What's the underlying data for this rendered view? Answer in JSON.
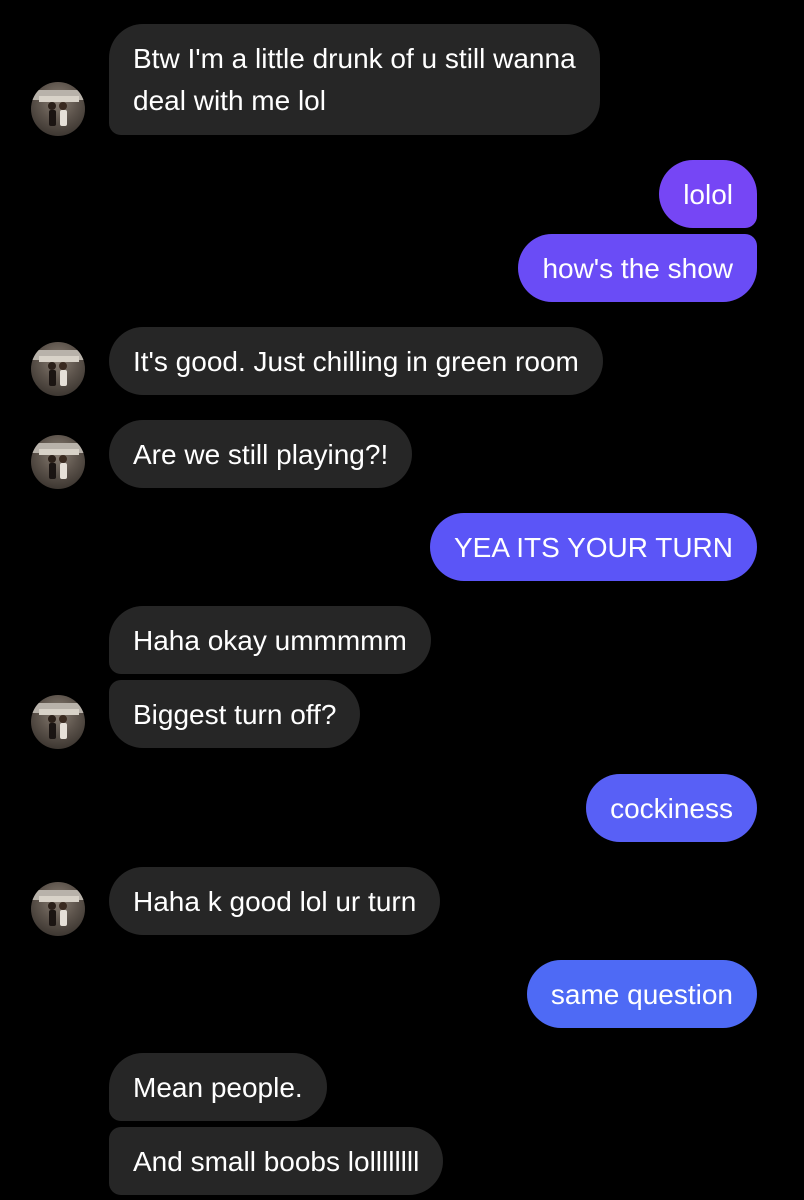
{
  "colors": {
    "background": "#000000",
    "incoming_bubble": "#262626",
    "outgoing_purple": "#7646F5",
    "outgoing_violet": "#6A4CF6",
    "outgoing_indigo": "#5B55F7",
    "outgoing_blue_violet": "#5860F6",
    "outgoing_blue": "#4E6AF5"
  },
  "icons": {
    "avatar": "contact-avatar-photo"
  },
  "messages": [
    {
      "direction": "incoming",
      "text_line1": "Btw I'm a little drunk of u still wanna",
      "text_line2": "deal with me lol"
    },
    {
      "direction": "outgoing",
      "text": "lolol"
    },
    {
      "direction": "outgoing",
      "text": "how's the show"
    },
    {
      "direction": "incoming",
      "text": "It's good. Just chilling in green room"
    },
    {
      "direction": "incoming",
      "text": "Are we still playing?!"
    },
    {
      "direction": "outgoing",
      "text": "YEA ITS YOUR TURN"
    },
    {
      "direction": "incoming",
      "text": "Haha okay ummmmm"
    },
    {
      "direction": "incoming",
      "text": "Biggest turn off?"
    },
    {
      "direction": "outgoing",
      "text": "cockiness"
    },
    {
      "direction": "incoming",
      "text": "Haha k good lol ur turn"
    },
    {
      "direction": "outgoing",
      "text": "same question"
    },
    {
      "direction": "incoming",
      "text": "Mean people."
    },
    {
      "direction": "incoming",
      "text": "And small boobs lollllllll"
    }
  ]
}
